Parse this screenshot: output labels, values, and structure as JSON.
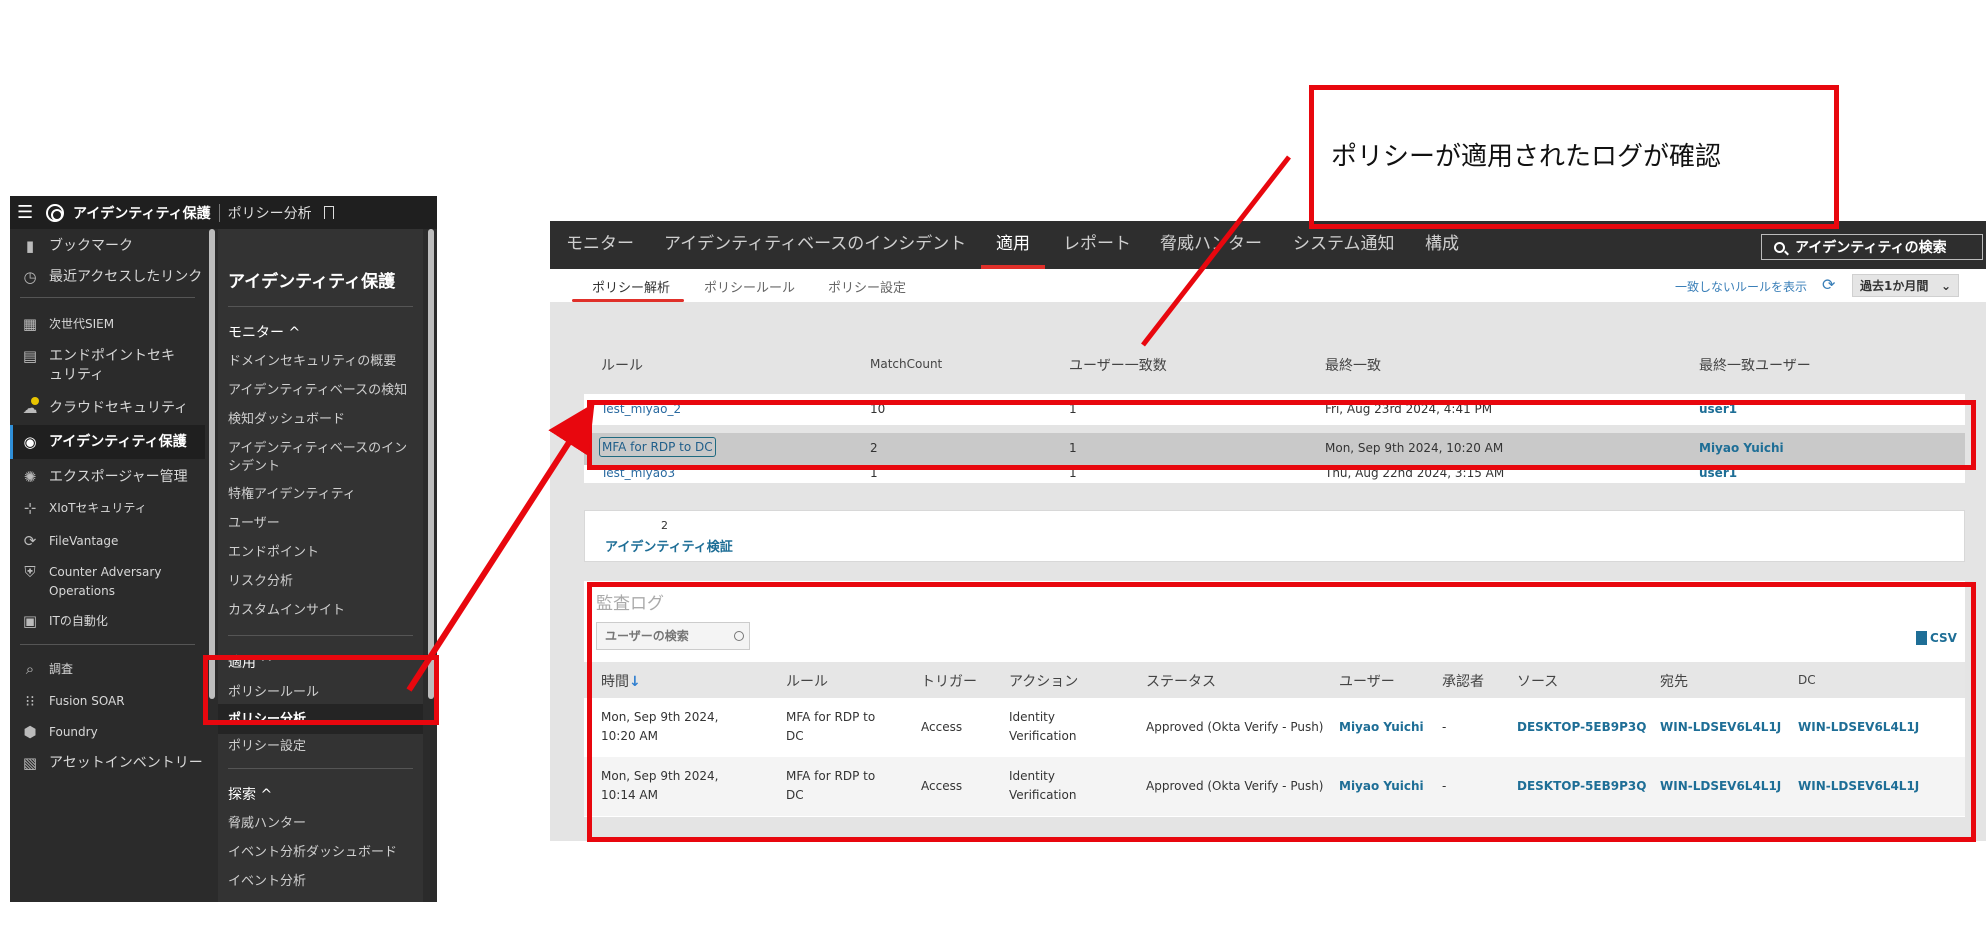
{
  "left_panel": {
    "topbar": {
      "app_title": "アイデンティティ保護",
      "page_title": "ポリシー分析"
    },
    "nav_items": [
      {
        "label": "ブックマーク",
        "icon": "bookmark-icon"
      },
      {
        "label": "最近アクセスしたリンク",
        "icon": "clock-icon"
      },
      {
        "label": "次世代SIEM",
        "icon": "siem-icon"
      },
      {
        "label": "エンドポイントセキュリティ",
        "icon": "endpoint-icon"
      },
      {
        "label": "クラウドセキュリティ",
        "icon": "cloud-icon"
      },
      {
        "label": "アイデンティティ保護",
        "icon": "fingerprint-icon"
      },
      {
        "label": "エクスポージャー管理",
        "icon": "sun-icon"
      },
      {
        "label": "XIoTセキュリティ",
        "icon": "network-icon"
      },
      {
        "label": "FileVantage",
        "icon": "refresh-icon"
      },
      {
        "label": "Counter Adversary Operations",
        "icon": "shield-icon"
      },
      {
        "label": "ITの自動化",
        "icon": "terminal-icon"
      },
      {
        "label": "調査",
        "icon": "search-icon"
      },
      {
        "label": "Fusion SOAR",
        "icon": "grid-icon"
      },
      {
        "label": "Foundry",
        "icon": "foundry-icon"
      },
      {
        "label": "アセットインベントリー",
        "icon": "inventory-icon"
      }
    ],
    "sub_nav": {
      "title": "アイデンティティ保護",
      "monitor_header": "モニター ^",
      "monitor_items": [
        "ドメインセキュリティの概要",
        "アイデンティティベースの検知",
        "検知ダッシュボード",
        "アイデンティティベースのインシデント",
        "特権アイデンティティ",
        "ユーザー",
        "エンドポイント",
        "リスク分析",
        "カスタムインサイト"
      ],
      "apply_header": "適用 ^",
      "apply_items": [
        "ポリシールール",
        "ポリシー分析",
        "ポリシー設定"
      ],
      "explore_header": "探索 ^",
      "explore_items": [
        "脅威ハンター",
        "イベント分析ダッシュボード",
        "イベント分析"
      ]
    }
  },
  "right_app": {
    "top_tabs": [
      "モニター",
      "アイデンティティベースのインシデント",
      "適用",
      "レポート",
      "脅威ハンター",
      "システム通知",
      "構成"
    ],
    "active_top_tab": "適用",
    "search_label": "アイデンティティの検索",
    "sub_tabs": [
      "ポリシー解析",
      "ポリシールール",
      "ポリシー設定"
    ],
    "show_unmatched": "一致しないルールを表示",
    "time_range": "過去1か月間",
    "rules_table": {
      "headers": [
        "ルール",
        "MatchCount",
        "ユーザー一致数",
        "最終一致",
        "最終一致ユーザー"
      ],
      "rows": [
        {
          "rule": "Test_miyao_2",
          "count": "10",
          "users": "1",
          "last": "Fri, Aug 23rd 2024, 4:41 PM",
          "user": "user1"
        },
        {
          "rule": "MFA for RDP to DC",
          "count": "2",
          "users": "1",
          "last": "Mon, Sep 9th 2024, 10:20 AM",
          "user": "Miyao Yuichi"
        },
        {
          "rule": "Test_miyao3",
          "count": "1",
          "users": "1",
          "last": "Thu, Aug 22nd 2024, 3:15 AM",
          "user": "user1"
        }
      ]
    },
    "identity_verification": {
      "count": "2",
      "label": "アイデンティティ検証"
    },
    "audit_log": {
      "title": "監査ログ",
      "search_placeholder": "ユーザーの検索",
      "csv_label": "CSV",
      "headers": [
        "時間",
        "ルール",
        "トリガー",
        "アクション",
        "ステータス",
        "ユーザー",
        "承認者",
        "ソース",
        "宛先",
        "DC"
      ],
      "sort_arrow": "↓",
      "rows": [
        {
          "time": "Mon, Sep 9th 2024, 10:20 AM",
          "rule": "MFA for RDP to DC",
          "trigger": "Access",
          "action": "Identity Verification",
          "status": "Approved (Okta Verify - Push)",
          "user": "Miyao Yuichi",
          "approver": "-",
          "source": "DESKTOP-5EB9P3Q",
          "dest": "WIN-LDSEV6L4L1J",
          "dc": "WIN-LDSEV6L4L1J"
        },
        {
          "time": "Mon, Sep 9th 2024, 10:14 AM",
          "rule": "MFA for RDP to DC",
          "trigger": "Access",
          "action": "Identity Verification",
          "status": "Approved (Okta Verify - Push)",
          "user": "Miyao Yuichi",
          "approver": "-",
          "source": "DESKTOP-5EB9P3Q",
          "dest": "WIN-LDSEV6L4L1J",
          "dc": "WIN-LDSEV6L4L1J"
        }
      ]
    }
  },
  "annotation": {
    "callout": "ポリシーが適用されたログが確認",
    "color": "#e8070e"
  }
}
